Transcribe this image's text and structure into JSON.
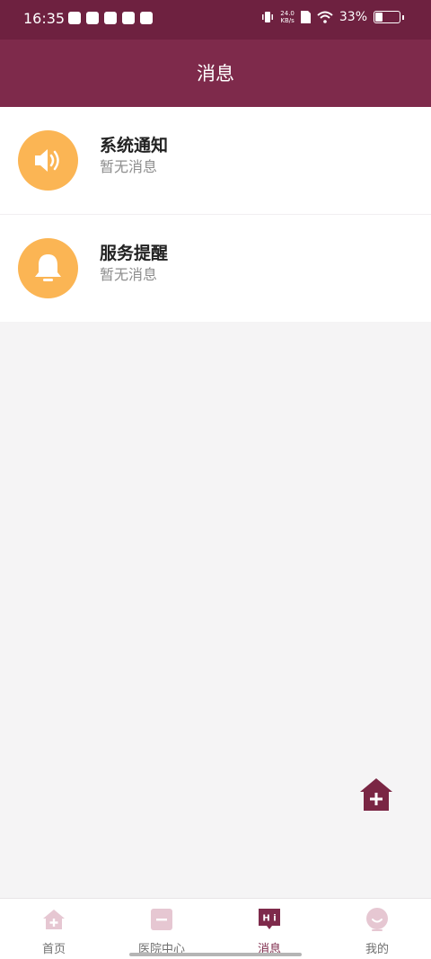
{
  "status": {
    "time": "16:35",
    "net_speed_top": "24.0",
    "net_speed_bottom": "KB/s",
    "battery": "33%"
  },
  "header": {
    "title": "消息"
  },
  "messages": [
    {
      "title": "系统通知",
      "subtitle": "暂无消息",
      "icon": "speaker-icon"
    },
    {
      "title": "服务提醒",
      "subtitle": "暂无消息",
      "icon": "bell-icon"
    }
  ],
  "tabs": [
    {
      "label": "首页",
      "icon": "home-plus-icon"
    },
    {
      "label": "医院中心",
      "icon": "hospital-icon"
    },
    {
      "label": "消息",
      "icon": "chat-hi-icon",
      "active": true
    },
    {
      "label": "我的",
      "icon": "profile-icon"
    }
  ],
  "colors": {
    "status_bar": "#6e2140",
    "header": "#7e2a4b",
    "avatar": "#fbb554",
    "active_tab": "#7e2a4b"
  }
}
